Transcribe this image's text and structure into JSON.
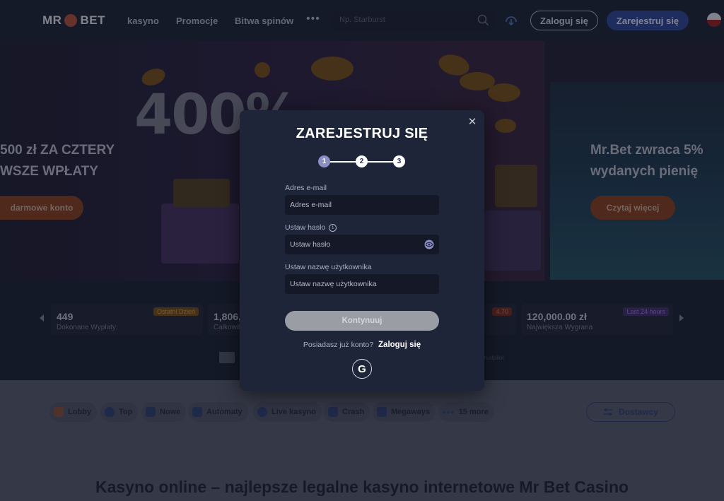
{
  "header": {
    "logo_text_left": "MR",
    "logo_text_right": "BET",
    "nav": [
      "kasyno",
      "Promocje",
      "Bitwa spinów"
    ],
    "more": "•••",
    "search_placeholder": "Np. Starburst",
    "login_label": "Zaloguj się",
    "register_label": "Zarejestruj się"
  },
  "hero": {
    "big_text": "400%",
    "left_title_line1": "500 zł ZA CZTERY",
    "left_title_line2": "WSZE WPŁATY",
    "left_button": "darmowe konto",
    "right_title_line1": "Mr.Bet zwraca 5%",
    "right_title_line2": "wydanych pienię",
    "right_button": "Czytaj więcej"
  },
  "stats": [
    {
      "value": "449",
      "label": "Dokonane Wypłaty:",
      "badge": "Ostatni Dzień"
    },
    {
      "value": "1,806,",
      "label": "Całkowit",
      "badge": ""
    },
    {
      "value": "",
      "label": "",
      "badge": "4.70"
    },
    {
      "value": "120,000.00 zł",
      "label": "Największa Wygrana",
      "badge": "Last 24 hours"
    }
  ],
  "trustpilot": "Trustpilot",
  "categories": [
    {
      "label": "Lobby",
      "icon": "home-icon"
    },
    {
      "label": "Top",
      "icon": "flame-icon"
    },
    {
      "label": "Nowe",
      "icon": "bolt-icon"
    },
    {
      "label": "Automaty",
      "icon": "slot-icon"
    },
    {
      "label": "Live kasyno",
      "icon": "person-icon"
    },
    {
      "label": "Crash",
      "icon": "rocket-icon"
    },
    {
      "label": "Megaways",
      "icon": "megaways-icon"
    },
    {
      "label": "15 more",
      "icon": "dots-icon"
    }
  ],
  "providers_label": "Dostawcy",
  "page_heading": "Kasyno online – najlepsze legalne kasyno internetowe Mr Bet Casino",
  "modal": {
    "title": "ZAREJESTRUJ SIĘ",
    "steps": [
      "1",
      "2",
      "3"
    ],
    "active_step": 1,
    "email_label": "Adres e-mail",
    "email_placeholder": "Adres e-mail",
    "password_label": "Ustaw hasło",
    "password_placeholder": "Ustaw hasło",
    "username_label": "Ustaw nazwę użytkownika",
    "username_placeholder": "Ustaw nazwę użytkownika",
    "continue_label": "Kontynuuj",
    "have_account": "Posiadasz już konto?",
    "login_link": "Zaloguj się",
    "google_glyph": "G"
  },
  "colors": {
    "modal_bg": "#1f2539",
    "step_active": "#8c8ec6",
    "register_btn": "#2c3f8c",
    "continue_disabled": "#9b9da5"
  }
}
